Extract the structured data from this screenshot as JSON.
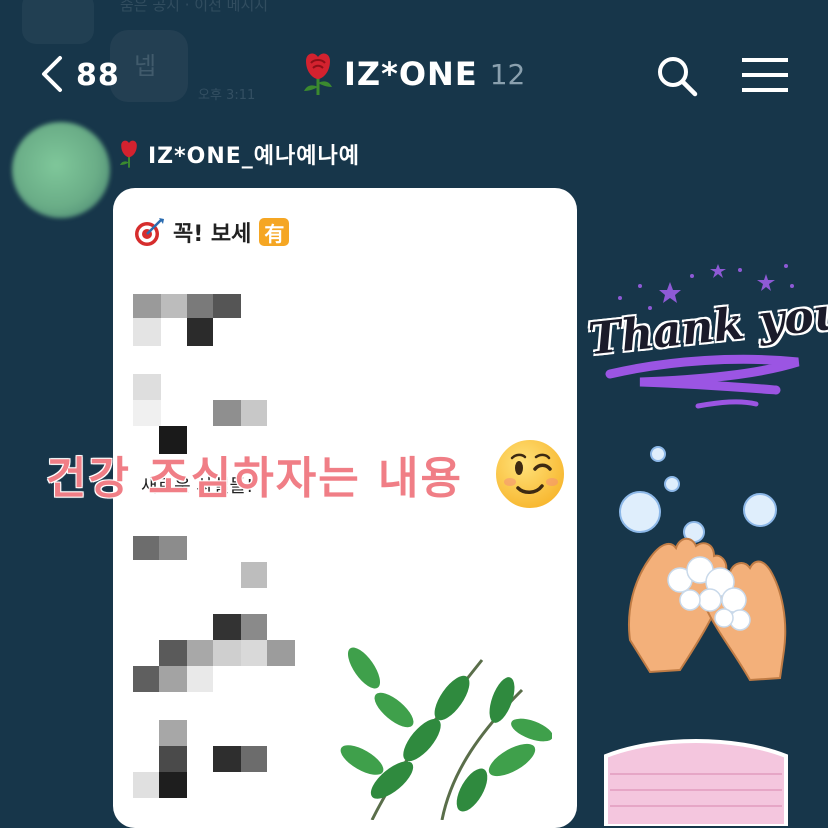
{
  "ghost": {
    "top_text": "숨은 공지 · 이전 메시지",
    "reply": "넵",
    "time": "오후 3:11"
  },
  "header": {
    "back_count": "88",
    "room_title": "IZ*ONE",
    "member_count": "12",
    "title_icon": "rose-icon"
  },
  "message": {
    "sender": "IZ*ONE_예나예나예",
    "sender_icon": "rose-icon",
    "header_icon": "dart-target-icon",
    "header_text": "꼭! 보세",
    "badge": "有",
    "visible_line": "새로운 사실들!"
  },
  "overlay": {
    "caption": "건강 조심하자는 내용",
    "emoji": "winking-face-emoji"
  },
  "stickers": {
    "thank_you": "Thank you!"
  },
  "colors": {
    "background": "#17364a",
    "bubble": "#ffffff",
    "caption": "#f07e86",
    "badge": "#f5a623",
    "rose": "#d3222f"
  }
}
